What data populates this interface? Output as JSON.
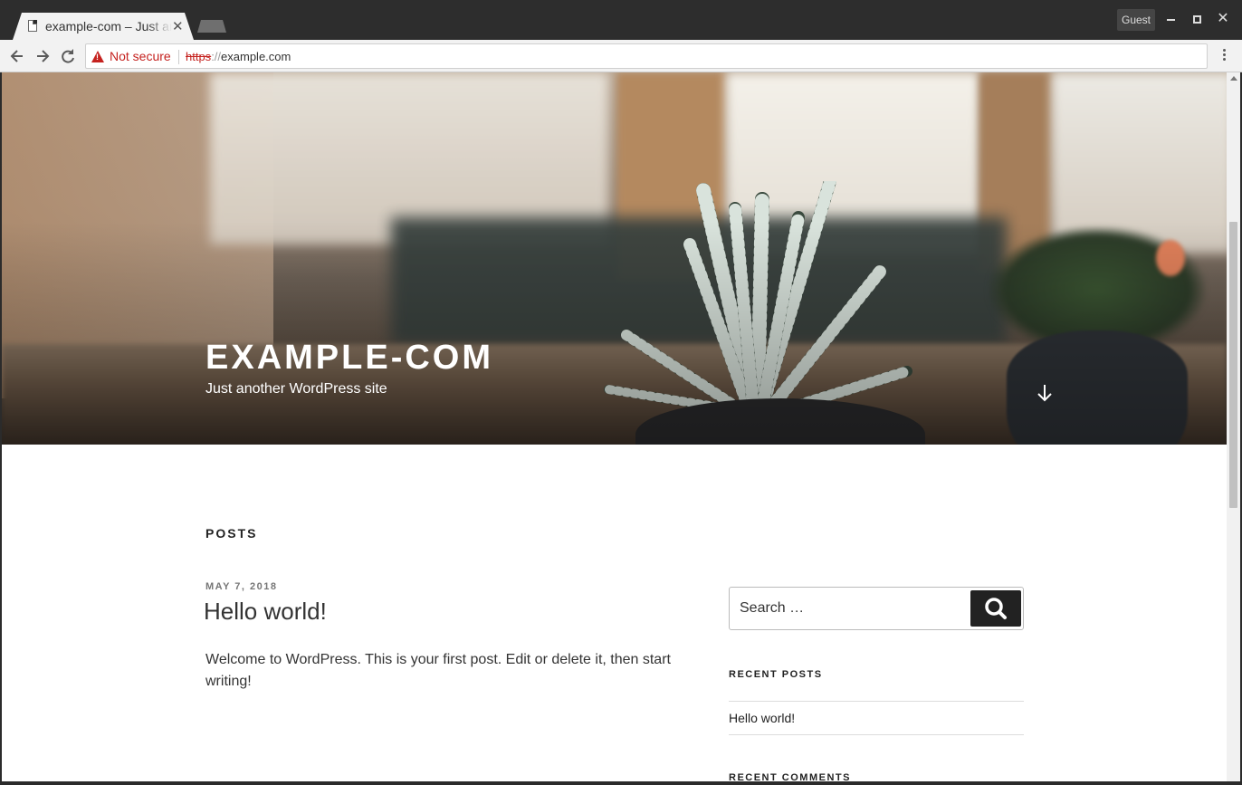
{
  "browser": {
    "tab": {
      "title": "example-com – Just another WordPress site"
    },
    "profile_label": "Guest",
    "omnibox": {
      "security_label": "Not secure",
      "url_scheme": "https",
      "url_separator": "://",
      "url_host": "example.com"
    }
  },
  "site": {
    "title": "EXAMPLE-COM",
    "description": "Just another WordPress site"
  },
  "content": {
    "section_heading": "POSTS",
    "post": {
      "date": "MAY 7, 2018",
      "title": "Hello world!",
      "excerpt": "Welcome to WordPress. This is your first post. Edit or delete it, then start writing!"
    }
  },
  "sidebar": {
    "search": {
      "placeholder": "Search …"
    },
    "recent_posts": {
      "heading": "RECENT POSTS",
      "items": [
        "Hello world!"
      ]
    },
    "recent_comments": {
      "heading": "RECENT COMMENTS"
    }
  },
  "colors": {
    "insecure_red": "#c5221f",
    "chrome_dark": "#2d2d2d",
    "button_dark": "#222222"
  }
}
